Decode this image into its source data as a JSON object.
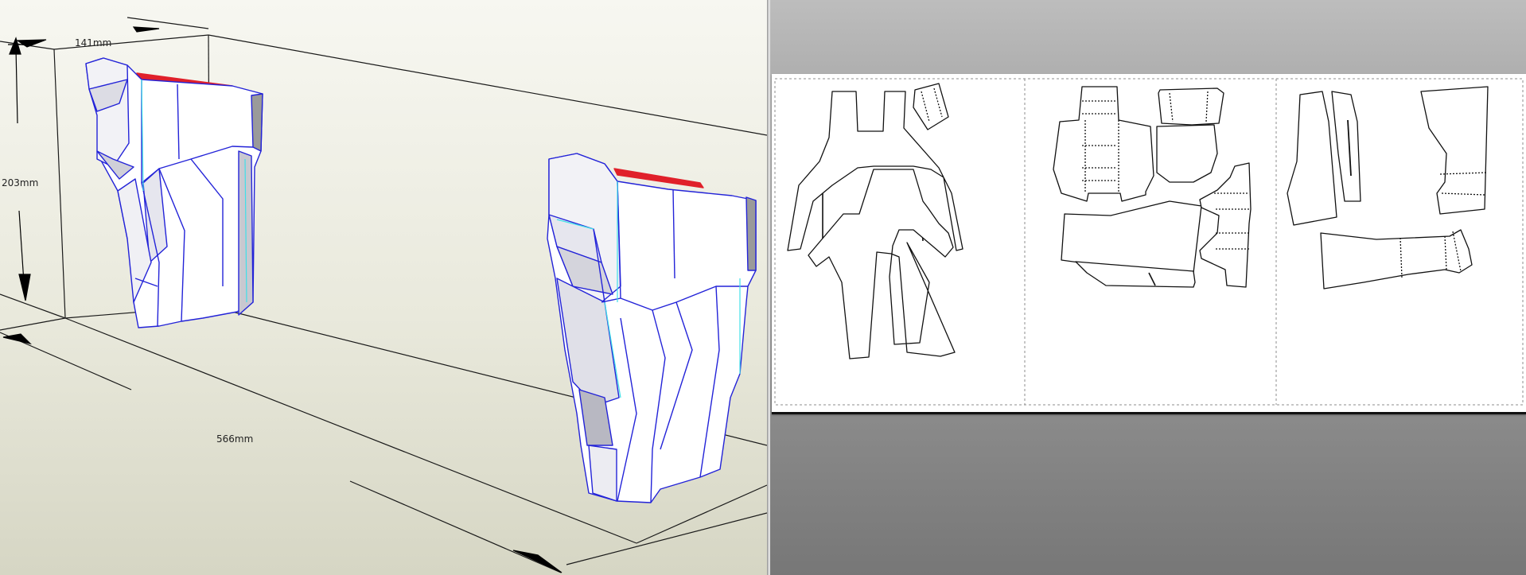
{
  "viewport_3d": {
    "dimensions": {
      "width_label": "141mm",
      "height_label": "203mm",
      "depth_label": "566mm"
    }
  },
  "view_2d": {
    "page_count": 3
  },
  "colors": {
    "model_edge": "#2323d8",
    "fold_edge": "#3fe0e8",
    "cut_edge_red": "#e0202a",
    "viewport_bg_top": "#f7f7f1",
    "viewport_bg_bottom": "#d6d6c4",
    "sheet_bg": "#ffffff"
  }
}
